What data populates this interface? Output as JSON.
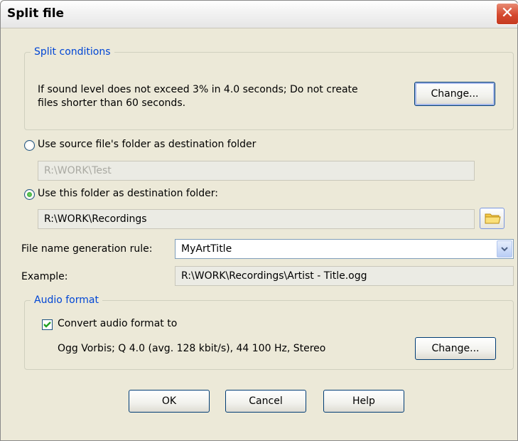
{
  "window": {
    "title": "Split file",
    "close_glyph": "✕"
  },
  "split_conditions": {
    "legend": "Split conditions",
    "line1": "If sound level does not exceed 3% in 4.0 seconds; Do not create",
    "line2": "files shorter than 60 seconds.",
    "change_label": "Change..."
  },
  "destination": {
    "source_option_label": "Use source file's folder as destination folder",
    "source_path": "R:\\WORK\\Test",
    "this_folder_option_label": "Use this folder as destination folder:",
    "this_folder_path": "R:\\WORK\\Recordings",
    "selected": "this_folder"
  },
  "filename": {
    "rule_label": "File name generation rule:",
    "rule_value": "MyArtTitle",
    "example_label": "Example:",
    "example_value": "R:\\WORK\\Recordings\\Artist - Title.ogg"
  },
  "audio_format": {
    "legend": "Audio format",
    "convert_label": "Convert audio format to",
    "convert_checked": true,
    "format_text": "Ogg Vorbis; Q 4.0 (avg. 128 kbit/s), 44 100 Hz, Stereo",
    "change_label": "Change..."
  },
  "buttons": {
    "ok": "OK",
    "cancel": "Cancel",
    "help": "Help"
  },
  "colors": {
    "legend": "#0046d5",
    "dialog_bg": "#ece9d8",
    "accent_border": "#003c74"
  }
}
